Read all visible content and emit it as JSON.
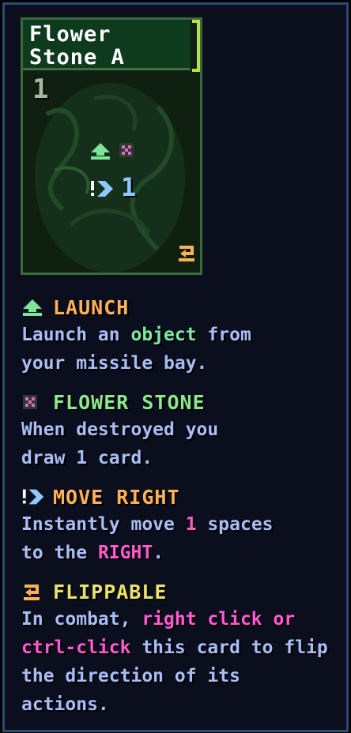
{
  "card": {
    "title": "Flower Stone A",
    "cost": "1",
    "move_value": "1",
    "icons": [
      "launch-icon",
      "flower-stone-icon",
      "move-right-icon",
      "flippable-icon"
    ]
  },
  "colors": {
    "panel_bg": "#0b0e1c",
    "panel_border": "#2c4a78",
    "body_text": "#a9bdf7",
    "orange": "#ffb15a",
    "green": "#82e6a0",
    "pink": "#ff5ad0",
    "yellow": "#e8e26a"
  },
  "launch": {
    "heading": "LAUNCH",
    "line1_a": "Launch an ",
    "line1_object": "object",
    "line1_b": " from",
    "line2": "your missile bay."
  },
  "flower_stone": {
    "heading": "FLOWER STONE",
    "line1": "When destroyed you",
    "line2": "draw 1 card."
  },
  "move_right": {
    "heading": "MOVE RIGHT",
    "line1_a": "Instantly move ",
    "line1_num": "1",
    "line1_b": " spaces",
    "line2_a": "to the ",
    "line2_right": "RIGHT",
    "line2_b": "."
  },
  "flippable": {
    "heading": "FLIPPABLE",
    "line1_a": "In combat, ",
    "line1_pink": "right click or",
    "line2_pink": "ctrl-click",
    "line2_b": " this card to flip",
    "line3": "the direction of its",
    "line4": "actions."
  }
}
